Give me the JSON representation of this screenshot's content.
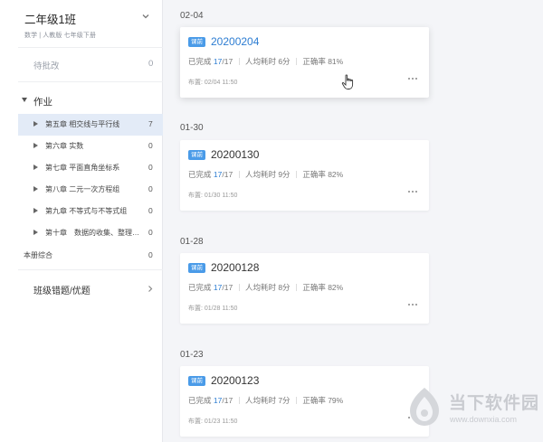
{
  "sidebar": {
    "class_title": "二年级1班",
    "class_subtitle": "数学 | 人教版 七年级下册",
    "pending": {
      "label": "待批改",
      "count": "0"
    },
    "homework_label": "作业",
    "chapters": [
      {
        "label": "第五章 相交线与平行线",
        "count": "7",
        "active": true
      },
      {
        "label": "第六章 实数",
        "count": "0"
      },
      {
        "label": "第七章 平面直角坐标系",
        "count": "0"
      },
      {
        "label": "第八章 二元一次方程组",
        "count": "0"
      },
      {
        "label": "第九章 不等式与不等式组",
        "count": "0"
      },
      {
        "label": "第十章　数据的收集、整理…",
        "count": "0"
      }
    ],
    "book_item": {
      "label": "本册综合",
      "count": "0"
    },
    "mistakes_label": "班级错题/优题"
  },
  "assignments": [
    {
      "date": "02-04",
      "tag": "课前",
      "title": "20200204",
      "done_label": "已完成",
      "done": "17",
      "total": "/17",
      "avg_label": "人均耗时",
      "avg": "6分",
      "acc_label": "正确率",
      "acc": "81%",
      "assigned": "布置: 02/04 11:50"
    },
    {
      "date": "01-30",
      "tag": "课前",
      "title": "20200130",
      "done_label": "已完成",
      "done": "17",
      "total": "/17",
      "avg_label": "人均耗时",
      "avg": "9分",
      "acc_label": "正确率",
      "acc": "82%",
      "assigned": "布置: 01/30 11:50"
    },
    {
      "date": "01-28",
      "tag": "课前",
      "title": "20200128",
      "done_label": "已完成",
      "done": "17",
      "total": "/17",
      "avg_label": "人均耗时",
      "avg": "8分",
      "acc_label": "正确率",
      "acc": "82%",
      "assigned": "布置: 01/28 11:50"
    },
    {
      "date": "01-23",
      "tag": "课前",
      "title": "20200123",
      "done_label": "已完成",
      "done": "17",
      "total": "/17",
      "avg_label": "人均耗时",
      "avg": "7分",
      "acc_label": "正确率",
      "acc": "79%",
      "assigned": "布置: 01/23 11:50"
    }
  ],
  "more_icon": "ellipsis-icon",
  "watermark": {
    "name": "当下软件园",
    "url": "www.downxia.com"
  },
  "colors": {
    "accent": "#2d7dd2",
    "tag": "#4a9be8",
    "active_row": "#e3ebf7"
  }
}
